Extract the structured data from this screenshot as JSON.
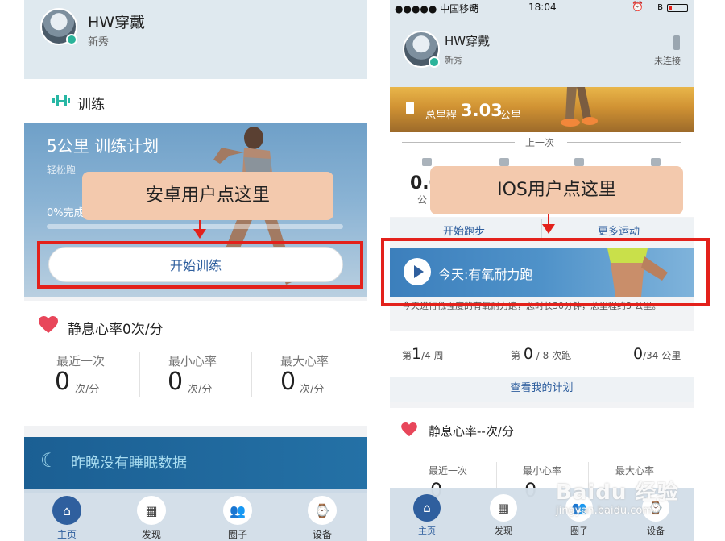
{
  "left": {
    "profile": {
      "name": "HW穿戴",
      "level": "新秀"
    },
    "training": {
      "section_title": "训练",
      "plan_title": "5公里 训练计划",
      "plan_subtitle": "轻松跑",
      "progress_text": "0%完成",
      "progress": 0.0,
      "start_button": "开始训练"
    },
    "callout": "安卓用户点这里",
    "heart_rate": {
      "title": "静息心率0次/分",
      "stats": [
        {
          "label": "最近一次",
          "value": "0",
          "unit": "次/分"
        },
        {
          "label": "最小心率",
          "value": "0",
          "unit": "次/分"
        },
        {
          "label": "最大心率",
          "value": "0",
          "unit": "次/分"
        }
      ]
    },
    "sleep": {
      "text": "昨晚没有睡眠数据"
    },
    "tabs": [
      {
        "label": "主页",
        "icon": "home-icon",
        "active": true
      },
      {
        "label": "发现",
        "icon": "grid-icon",
        "active": false
      },
      {
        "label": "圈子",
        "icon": "people-icon",
        "active": false
      },
      {
        "label": "设备",
        "icon": "watch-icon",
        "active": false
      }
    ]
  },
  "right": {
    "status_bar": {
      "carrier": "●●●●● 中国移动",
      "time": "18:04"
    },
    "profile": {
      "name": "HW穿戴",
      "level": "新秀",
      "device_status": "未连接"
    },
    "total_distance": {
      "label": "总里程",
      "value": "3.03",
      "unit": "公里"
    },
    "last_session": {
      "label": "上一次",
      "value": "0.0",
      "unit": "公"
    },
    "callout": "IOS用户点这里",
    "actions": {
      "start_run": "开始跑步",
      "more_sports": "更多运动"
    },
    "today": {
      "label": "今天:有氧耐力跑",
      "description": "今天进行低强度的有氧耐力跑，总时长30分钟，总里程约3 公里。"
    },
    "plan_progress": {
      "week": {
        "prefix": "第",
        "value": "1",
        "suffix": "/4 周"
      },
      "runs": {
        "prefix": "第",
        "value": "0",
        "suffix": "/ 8 次跑"
      },
      "distance": {
        "value": "0",
        "suffix": "/34 公里"
      }
    },
    "view_plan": "查看我的计划",
    "heart_rate": {
      "title": "静息心率--次/分",
      "stats": [
        {
          "label": "最近一次",
          "value": "0"
        },
        {
          "label": "最小心率",
          "value": "0"
        },
        {
          "label": "最大心率",
          "value": ""
        }
      ]
    },
    "tabs": [
      {
        "label": "主页",
        "icon": "home-icon",
        "active": true
      },
      {
        "label": "发现",
        "icon": "grid-icon",
        "active": false
      },
      {
        "label": "圈子",
        "icon": "people-icon",
        "active": false
      },
      {
        "label": "设备",
        "icon": "watch-icon",
        "active": false
      }
    ]
  },
  "watermark": {
    "brand": "Baidu 经验",
    "url": "jingyan.baidu.com"
  },
  "colors": {
    "accent": "#2f5f9e",
    "highlight": "#e3211b",
    "callout": "#f3c9ad",
    "heart": "#e8465a",
    "training_icon": "#28b7a4"
  }
}
